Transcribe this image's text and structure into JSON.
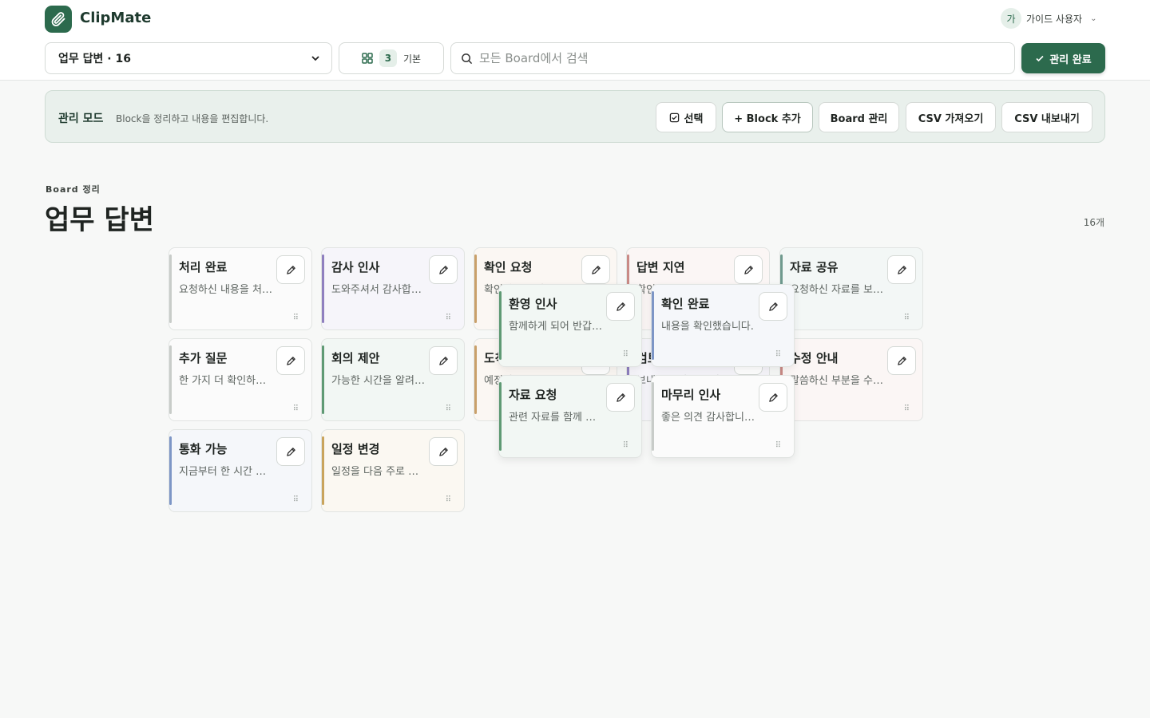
{
  "app": {
    "name": "ClipMate"
  },
  "user": {
    "avatar_initial": "가",
    "name": "가이드 사용자"
  },
  "toolbar": {
    "board_select": "업무 답변 · 16",
    "view_count": "3",
    "view_label": "기본",
    "search_placeholder": "모든 Board에서 검색",
    "done_label": "관리 완료"
  },
  "manage": {
    "title": "관리 모드",
    "description": "Block을 정리하고 내용을 편집합니다.",
    "buttons": {
      "select": "선택",
      "add_block": "+ Block 추가",
      "board_manage": "Board 관리",
      "csv_import": "CSV 가져오기",
      "csv_export": "CSV 내보내기"
    }
  },
  "section": {
    "eyebrow": "Board 정리",
    "title": "업무 답변",
    "count": "16개"
  },
  "colors": {
    "brand": "#2c6a4d",
    "gray": "#c8ccc9",
    "purple": "#8f7fbf",
    "orange": "#c9a06a",
    "red": "#c98a86",
    "teal": "#6f9a8e",
    "green": "#5f9a74",
    "blue": "#7d96c6",
    "gold": "#c9a45c"
  },
  "cards": [
    {
      "title": "처리 완료",
      "body": "요청하신 내용을 처리했습니다.",
      "color": "gray"
    },
    {
      "title": "감사 인사",
      "body": "도와주셔서 감사합니다.",
      "color": "purple"
    },
    {
      "title": "확인 요청",
      "body": "확인하시면 답 주세요.",
      "color": "orange"
    },
    {
      "title": "답변 지연",
      "body": "확인에 시간이 조금 걸립니다.",
      "color": "red"
    },
    {
      "title": "자료 공유",
      "body": "요청하신 자료를 보내드립니다.",
      "color": "teal"
    },
    {
      "title": "추가 질문",
      "body": "한 가지 더 확인하고 싶습니다.",
      "color": "gray"
    },
    {
      "title": "회의 제안",
      "body": "가능한 시간을 알려주세요.",
      "color": "green"
    },
    {
      "title": "도착 예정",
      "body": "예정된 시간에 도착합니다.",
      "color": "orange"
    },
    {
      "title": "검토 중",
      "body": "보내주신 자료를 검토 중입니다.",
      "color": "purple"
    },
    {
      "title": "수정 안내",
      "body": "말씀하신 부분을 수정했습니다.",
      "color": "red"
    },
    {
      "title": "통화 가능",
      "body": "지금부터 한 시간 통화 가능합니다.",
      "color": "blue"
    },
    {
      "title": "일정 변경",
      "body": "일정을 다음 주로 변경합니다.",
      "color": "gold"
    },
    {
      "title": "환영 인사",
      "body": "함께하게 되어 반갑습니다.",
      "color": "green"
    },
    {
      "title": "확인 완료",
      "body": "내용을 확인했습니다.",
      "color": "blue"
    },
    {
      "title": "자료 요청",
      "body": "관련 자료를 함께 보내주세요.",
      "color": "green"
    },
    {
      "title": "마무리 인사",
      "body": "좋은 의견 감사합니다.",
      "color": "gray"
    }
  ]
}
